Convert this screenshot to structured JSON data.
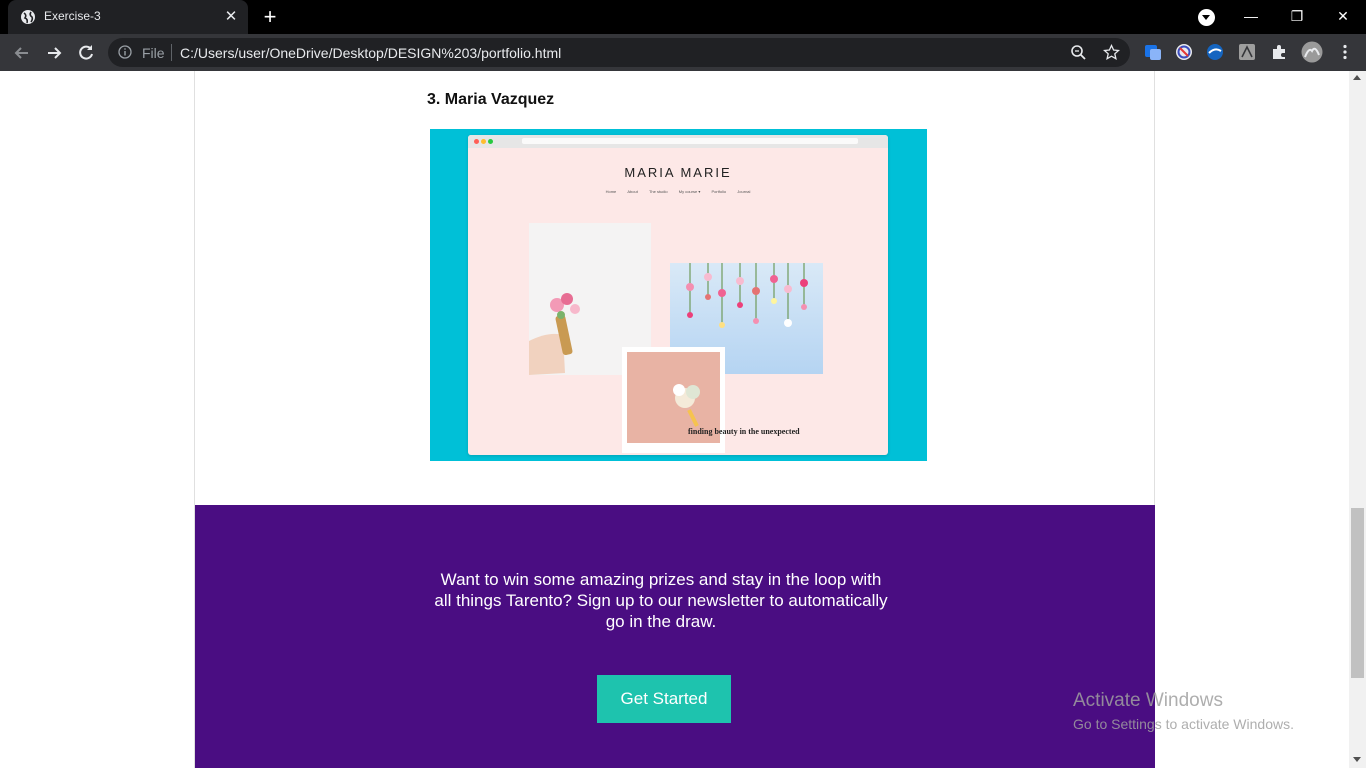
{
  "browser": {
    "tab_title": "Exercise-3",
    "close_tab_symbol": "✕",
    "new_tab_symbol": "+",
    "address_scheme": "File",
    "address_url": "C:/Users/user/OneDrive/Desktop/DESIGN%203/portfolio.html",
    "window_controls": {
      "minimize": "—",
      "restore": "❐",
      "close": "✕"
    },
    "icons": [
      "back-arrow-icon",
      "forward-arrow-icon",
      "reload-icon",
      "info-icon",
      "zoom-icon",
      "star-icon",
      "extension-icons",
      "puzzle-icon",
      "profile-avatar",
      "menu-kebab-icon"
    ]
  },
  "page": {
    "item_heading": "3. Maria Vazquez",
    "preview": {
      "brand": "MARIA MARIE",
      "nav": [
        "Home",
        "About",
        "The studio",
        "My course ▾",
        "Portfolio",
        "Journal"
      ],
      "tagline": "finding beauty in the unexpected",
      "colors": {
        "backdrop": "#00c0d7",
        "page": "#fde8e7"
      }
    },
    "cta": {
      "text": "Want to win some amazing prizes and stay in the loop with all things Tarento? Sign up to our newsletter to automatically go in the draw.",
      "button_label": "Get Started",
      "background": "#4a0d82",
      "button_color": "#1ec3ae"
    }
  },
  "watermark": {
    "title": "Activate Windows",
    "subtitle": "Go to Settings to activate Windows."
  }
}
